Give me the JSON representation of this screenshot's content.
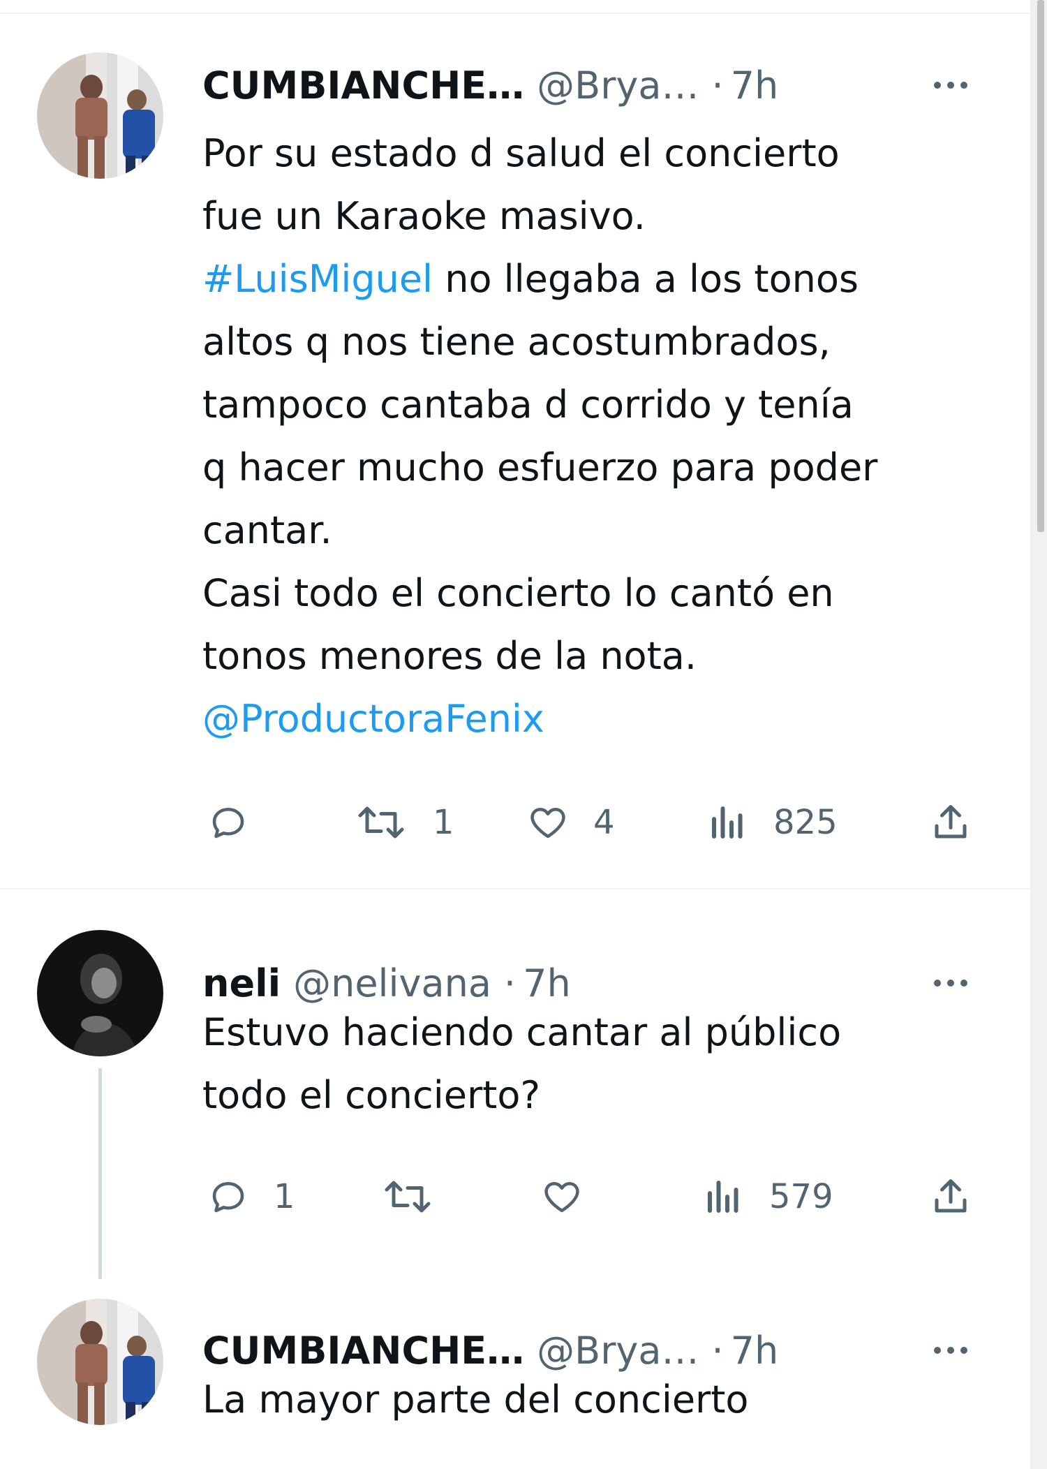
{
  "tweets": [
    {
      "name": "CUMBIANCHE…",
      "handle": "@Brya…",
      "sep": "·",
      "time": "7h",
      "lines": [
        [
          {
            "t": "Por su estado d salud el concierto"
          }
        ],
        [
          {
            "t": "fue un Karaoke masivo."
          }
        ],
        [
          {
            "t": "#LuisMiguel",
            "link": true
          },
          {
            "t": " no llegaba a los tonos"
          }
        ],
        [
          {
            "t": "altos q nos tiene acostumbrados,"
          }
        ],
        [
          {
            "t": "tampoco cantaba d corrido y tenía"
          }
        ],
        [
          {
            "t": "q hacer mucho esfuerzo para poder"
          }
        ],
        [
          {
            "t": "cantar."
          }
        ],
        [
          {
            "t": "Casi todo el concierto lo cantó en"
          }
        ],
        [
          {
            "t": "tonos menores de la nota."
          }
        ],
        [
          {
            "t": "@ProductoraFenix",
            "link": true
          }
        ]
      ],
      "reply_count": "",
      "retweet_count": "1",
      "like_count": "4",
      "views_count": "825"
    },
    {
      "name": "neli",
      "handle": "@nelivana",
      "sep": "·",
      "time": "7h",
      "lines": [
        [
          {
            "t": "Estuvo haciendo cantar al público"
          }
        ],
        [
          {
            "t": "todo el concierto?"
          }
        ]
      ],
      "reply_count": "1",
      "retweet_count": "",
      "like_count": "",
      "views_count": "579"
    },
    {
      "name": "CUMBIANCHE…",
      "handle": "@Brya…",
      "sep": "·",
      "time": "7h",
      "lines": [
        [
          {
            "t": "La mayor parte del concierto"
          }
        ]
      ]
    }
  ],
  "icons": {
    "reply": "reply-icon",
    "retweet": "retweet-icon",
    "like": "heart-icon",
    "views": "views-icon",
    "share": "share-icon",
    "more": "more-dots-icon"
  },
  "colors": {
    "link": "#1d9bf0",
    "muted": "#536471",
    "text": "#0f1419"
  }
}
